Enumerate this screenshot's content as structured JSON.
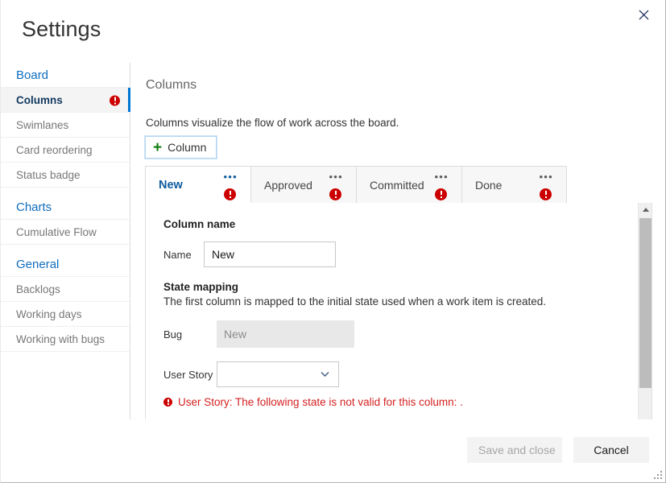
{
  "window": {
    "title": "Settings",
    "close_icon": "close-icon"
  },
  "sidebar": {
    "groups": [
      {
        "title": "Board",
        "items": [
          {
            "label": "Columns",
            "selected": true,
            "error": true
          },
          {
            "label": "Swimlanes",
            "selected": false,
            "error": false
          },
          {
            "label": "Card reordering",
            "selected": false,
            "error": false
          },
          {
            "label": "Status badge",
            "selected": false,
            "error": false
          }
        ]
      },
      {
        "title": "Charts",
        "items": [
          {
            "label": "Cumulative Flow",
            "selected": false,
            "error": false
          }
        ]
      },
      {
        "title": "General",
        "items": [
          {
            "label": "Backlogs",
            "selected": false,
            "error": false
          },
          {
            "label": "Working days",
            "selected": false,
            "error": false
          },
          {
            "label": "Working with bugs",
            "selected": false,
            "error": false
          }
        ]
      }
    ]
  },
  "main": {
    "section_title": "Columns",
    "description": "Columns visualize the flow of work across the board.",
    "add_column_label": "Column",
    "add_column_plus": "+",
    "tabs": [
      {
        "label": "New",
        "active": true,
        "error": true,
        "menu": "•••"
      },
      {
        "label": "Approved",
        "active": false,
        "error": true,
        "menu": "•••"
      },
      {
        "label": "Committed",
        "active": false,
        "error": true,
        "menu": "•••"
      },
      {
        "label": "Done",
        "active": false,
        "error": true,
        "menu": "•••"
      }
    ],
    "form": {
      "column_name_heading": "Column name",
      "name_label": "Name",
      "name_value": "New",
      "state_mapping_heading": "State mapping",
      "state_mapping_desc": "The first column is mapped to the initial state used when a work item is created.",
      "bug_label": "Bug",
      "bug_value": "New",
      "user_story_label": "User Story",
      "user_story_value": "",
      "error_message": "User Story: The following state is not valid for this column: ."
    }
  },
  "footer": {
    "save_label": "Save and close",
    "cancel_label": "Cancel"
  },
  "colors": {
    "accent": "#0078d4",
    "link": "#106ebe",
    "error": "#cc0000",
    "error_text": "#d42020",
    "plus_green": "#107c10"
  }
}
